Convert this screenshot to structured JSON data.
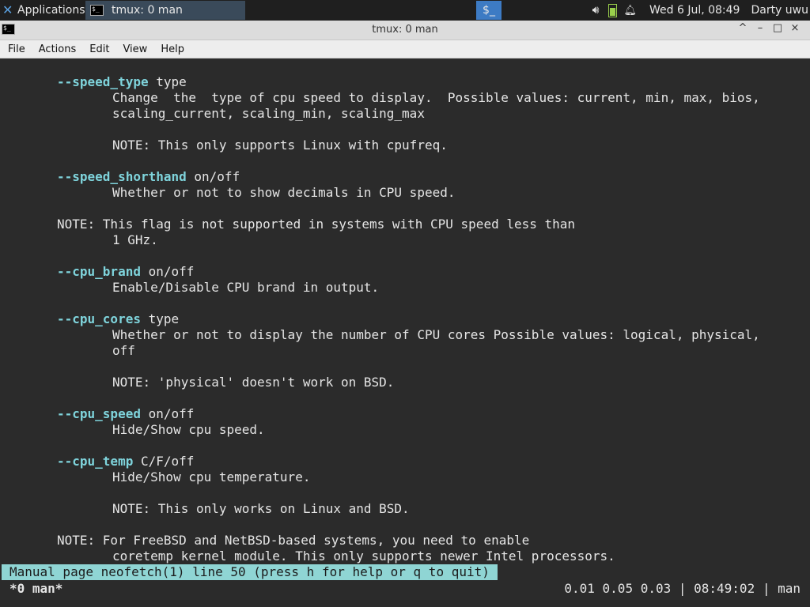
{
  "panel": {
    "applications": "Applications",
    "applications_suffix": "Ξ",
    "task_title": "tmux: 0 man",
    "clock": "Wed  6 Jul, 08:49",
    "user": "Darty uwu"
  },
  "window": {
    "title": "tmux: 0 man",
    "controls": {
      "shade": "^",
      "minimize": "–",
      "maximize": "□",
      "close": "×"
    }
  },
  "menu": [
    "File",
    "Actions",
    "Edit",
    "View",
    "Help"
  ],
  "terminal": {
    "lines": [
      {
        "opt": "--speed_type",
        "arg": " type"
      },
      "Change  the  type of cpu speed to display.  Possible values: current, min, max, bios,",
      "scaling_current, scaling_min, scaling_max",
      "NOTE: This only supports Linux with cpufreq.",
      {
        "opt": "--speed_shorthand",
        "arg": " on/off"
      },
      "Whether or not to show decimals in CPU speed.",
      "NOTE: This flag is not supported in systems with CPU speed less than",
      "1 GHz.",
      {
        "opt": "--cpu_brand",
        "arg": " on/off"
      },
      "Enable/Disable CPU brand in output.",
      {
        "opt": "--cpu_cores",
        "arg": " type"
      },
      "Whether or not to display the number of CPU cores Possible values: logical, physical,",
      "off",
      "NOTE: 'physical' doesn't work on BSD.",
      {
        "opt": "--cpu_speed",
        "arg": " on/off"
      },
      "Hide/Show cpu speed.",
      {
        "opt": "--cpu_temp",
        "arg": " C/F/off"
      },
      "Hide/Show cpu temperature.",
      "NOTE: This only works on Linux and BSD.",
      "NOTE: For FreeBSD and NetBSD-based systems, you need to enable",
      "coretemp kernel module. This only supports newer Intel processors."
    ],
    "pager_status": "Manual page neofetch(1) line 50 (press h for help or q to quit)",
    "tmux_window": "*0 man*",
    "tmux_right": "0.01 0.05 0.03 | 08:49:02 | man"
  },
  "colors": {
    "option": "#7fd4dc",
    "status_bg": "#8fd5d4",
    "workspace": "#3d7bc4"
  },
  "icons": [
    "xfce-icon",
    "terminal-icon",
    "volume-icon",
    "battery-icon",
    "bell-icon"
  ]
}
